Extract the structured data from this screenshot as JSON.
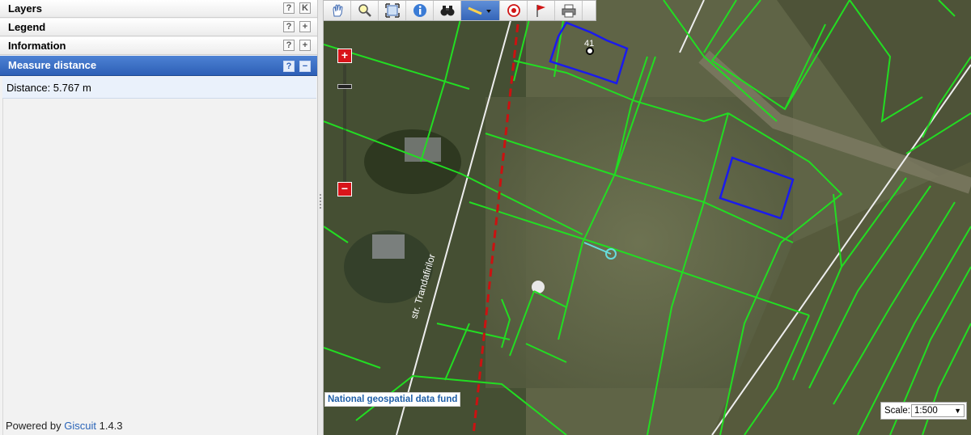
{
  "left_panel": {
    "sections": [
      {
        "title": "Layers",
        "buttons": [
          "?",
          "K"
        ]
      },
      {
        "title": "Legend",
        "buttons": [
          "?",
          "+"
        ]
      },
      {
        "title": "Information",
        "buttons": [
          "?",
          "+"
        ]
      },
      {
        "title": "Measure distance",
        "buttons": [
          "?",
          "−"
        ],
        "active": true
      }
    ],
    "measure": {
      "distance_text": "Distance: 5.767 m"
    },
    "footer": {
      "prefix": "Powered by ",
      "link": "Giscuit",
      "version": " 1.4.3"
    }
  },
  "toolbar": {
    "tools": [
      "pan-icon",
      "zoom-box-icon",
      "full-extent-icon",
      "info-icon",
      "binoculars-icon",
      "ruler-icon",
      "target-icon",
      "flag-icon",
      "print-icon"
    ],
    "active_tool": "ruler-icon"
  },
  "map": {
    "zoom_in": "+",
    "zoom_out": "−",
    "street_label": "str. Trandafirilor",
    "parcel_number": "41",
    "attribution": "National geospatial data fund",
    "scale_label": "Scale:",
    "scale_value": "1:500",
    "colors": {
      "parcels": "#22dd22",
      "selected": "#1a1aee",
      "measure": "#66dddd",
      "boundary": "#cc1111"
    }
  }
}
